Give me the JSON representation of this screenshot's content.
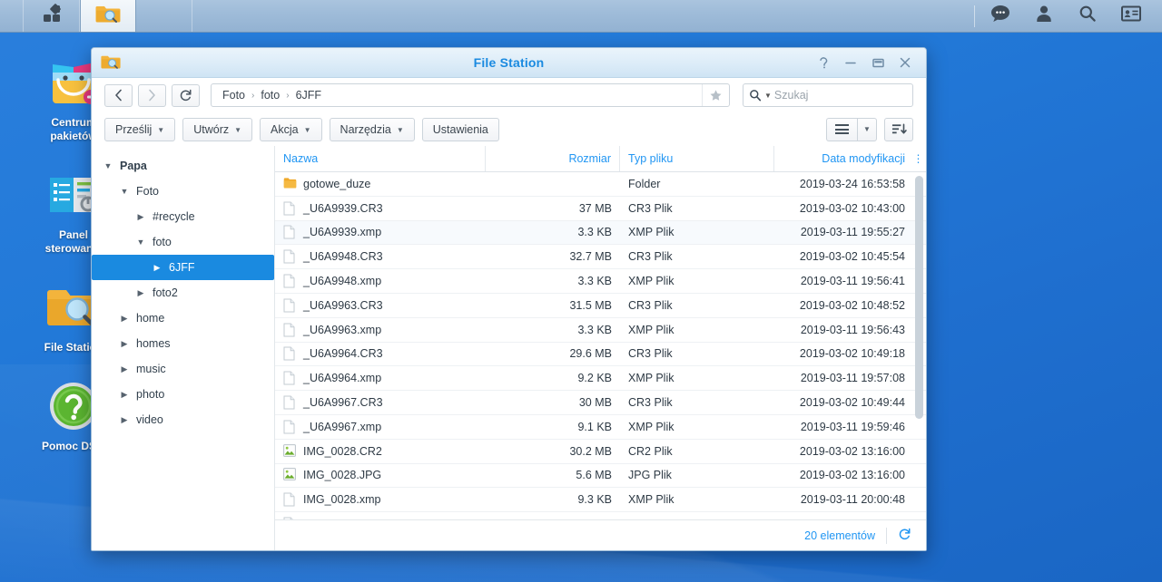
{
  "taskbar": {
    "left_items": [
      {
        "name": "main-menu",
        "icon": "grid-menu-icon"
      },
      {
        "name": "file-station-task",
        "icon": "file-station-icon",
        "active": true
      }
    ],
    "right_items": [
      {
        "name": "notifications",
        "icon": "chat-bubble-icon"
      },
      {
        "name": "account",
        "icon": "person-icon"
      },
      {
        "name": "search",
        "icon": "search-icon"
      },
      {
        "name": "widgets",
        "icon": "id-card-icon"
      }
    ]
  },
  "desktop": {
    "icons": [
      {
        "label": "Centrum\npakietów",
        "icon": "package-center-icon"
      },
      {
        "label": "Panel sterowania",
        "icon": "control-panel-icon"
      },
      {
        "label": "File Station",
        "icon": "file-station-icon"
      },
      {
        "label": "Pomoc DSM",
        "icon": "help-icon"
      }
    ]
  },
  "window": {
    "title": "File Station",
    "app_icon": "file-station-icon",
    "controls": {
      "help": "?",
      "minimize": "—",
      "maximize": "▭",
      "close": "✕"
    },
    "nav": {
      "back": "‹",
      "forward": "›",
      "refresh": "⟳",
      "breadcrumbs": [
        "Foto",
        "foto",
        "6JFF"
      ],
      "breadcrumb_separator": "›",
      "favorite_icon": "star-icon"
    },
    "search": {
      "placeholder": "Szukaj",
      "icon": "search-icon"
    },
    "toolbar": {
      "buttons": [
        {
          "label": "Prześlij",
          "has_caret": true
        },
        {
          "label": "Utwórz",
          "has_caret": true
        },
        {
          "label": "Akcja",
          "has_caret": true
        },
        {
          "label": "Narzędzia",
          "has_caret": true
        },
        {
          "label": "Ustawienia",
          "has_caret": false
        }
      ],
      "view_button": "list-view-icon",
      "view_caret": "▾",
      "sort_button": "sort-descending-icon"
    },
    "sidebar": {
      "items": [
        {
          "label": "Papa",
          "depth": 0,
          "twisty": "▾",
          "selected": false,
          "root": true
        },
        {
          "label": "Foto",
          "depth": 1,
          "twisty": "▾",
          "selected": false,
          "root": false
        },
        {
          "label": "#recycle",
          "depth": 2,
          "twisty": "▸",
          "selected": false,
          "root": false
        },
        {
          "label": "foto",
          "depth": 2,
          "twisty": "▾",
          "selected": false,
          "root": false
        },
        {
          "label": "6JFF",
          "depth": 3,
          "twisty": "▸",
          "selected": true,
          "root": false
        },
        {
          "label": "foto2",
          "depth": 2,
          "twisty": "▸",
          "selected": false,
          "root": false
        },
        {
          "label": "home",
          "depth": 1,
          "twisty": "▸",
          "selected": false,
          "root": false
        },
        {
          "label": "homes",
          "depth": 1,
          "twisty": "▸",
          "selected": false,
          "root": false
        },
        {
          "label": "music",
          "depth": 1,
          "twisty": "▸",
          "selected": false,
          "root": false
        },
        {
          "label": "photo",
          "depth": 1,
          "twisty": "▸",
          "selected": false,
          "root": false
        },
        {
          "label": "video",
          "depth": 1,
          "twisty": "▸",
          "selected": false,
          "root": false
        }
      ]
    },
    "filelist": {
      "columns": [
        "Nazwa",
        "Rozmiar",
        "Typ pliku",
        "Data modyfikacji"
      ],
      "column_menu_icon": "more-vertical-icon",
      "rows": [
        {
          "name": "gotowe_duze",
          "size": "",
          "type": "Folder",
          "date": "2019-03-24 16:53:58",
          "icon": "folder-icon",
          "alt": false
        },
        {
          "name": "_U6A9939.CR3",
          "size": "37 MB",
          "type": "CR3 Plik",
          "date": "2019-03-02 10:43:00",
          "icon": "document-icon",
          "alt": false
        },
        {
          "name": "_U6A9939.xmp",
          "size": "3.3 KB",
          "type": "XMP Plik",
          "date": "2019-03-11 19:55:27",
          "icon": "document-icon",
          "alt": true
        },
        {
          "name": "_U6A9948.CR3",
          "size": "32.7 MB",
          "type": "CR3 Plik",
          "date": "2019-03-02 10:45:54",
          "icon": "document-icon",
          "alt": false
        },
        {
          "name": "_U6A9948.xmp",
          "size": "3.3 KB",
          "type": "XMP Plik",
          "date": "2019-03-11 19:56:41",
          "icon": "document-icon",
          "alt": false
        },
        {
          "name": "_U6A9963.CR3",
          "size": "31.5 MB",
          "type": "CR3 Plik",
          "date": "2019-03-02 10:48:52",
          "icon": "document-icon",
          "alt": false
        },
        {
          "name": "_U6A9963.xmp",
          "size": "3.3 KB",
          "type": "XMP Plik",
          "date": "2019-03-11 19:56:43",
          "icon": "document-icon",
          "alt": false
        },
        {
          "name": "_U6A9964.CR3",
          "size": "29.6 MB",
          "type": "CR3 Plik",
          "date": "2019-03-02 10:49:18",
          "icon": "document-icon",
          "alt": false
        },
        {
          "name": "_U6A9964.xmp",
          "size": "9.2 KB",
          "type": "XMP Plik",
          "date": "2019-03-11 19:57:08",
          "icon": "document-icon",
          "alt": false
        },
        {
          "name": "_U6A9967.CR3",
          "size": "30 MB",
          "type": "CR3 Plik",
          "date": "2019-03-02 10:49:44",
          "icon": "document-icon",
          "alt": false
        },
        {
          "name": "_U6A9967.xmp",
          "size": "9.1 KB",
          "type": "XMP Plik",
          "date": "2019-03-11 19:59:46",
          "icon": "document-icon",
          "alt": false
        },
        {
          "name": "IMG_0028.CR2",
          "size": "30.2 MB",
          "type": "CR2 Plik",
          "date": "2019-03-02 13:16:00",
          "icon": "image-icon",
          "alt": false
        },
        {
          "name": "IMG_0028.JPG",
          "size": "5.6 MB",
          "type": "JPG Plik",
          "date": "2019-03-02 13:16:00",
          "icon": "image-icon",
          "alt": false
        },
        {
          "name": "IMG_0028.xmp",
          "size": "9.3 KB",
          "type": "XMP Plik",
          "date": "2019-03-11 20:00:48",
          "icon": "document-icon",
          "alt": false
        },
        {
          "name": "",
          "size": "",
          "type": "",
          "date": "",
          "icon": "document-icon",
          "alt": false
        }
      ]
    },
    "status": {
      "count_label": "20 elementów",
      "refresh_icon": "refresh-icon"
    }
  },
  "colors": {
    "accent": "#2196f3",
    "title_blue": "#1a8ae0",
    "selection": "#1a8ae0",
    "desktop": "#2279d8",
    "folder": "#f0a92a"
  }
}
